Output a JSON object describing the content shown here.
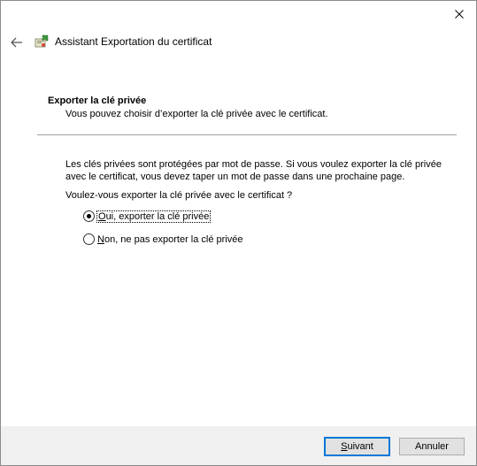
{
  "window": {
    "title": "Assistant Exportation du certificat",
    "close_icon": "close-icon",
    "back_icon": "back-arrow-icon",
    "wizard_icon": "certificate-wizard-icon"
  },
  "section": {
    "title": "Exporter la clé privée",
    "subtitle": "Vous pouvez choisir d’exporter la clé privée avec le certificat."
  },
  "info": {
    "text": "Les clés privées sont protégées par mot de passe. Si vous voulez exporter la clé privée avec le certificat, vous devez taper un mot de passe dans une prochaine page."
  },
  "question": "Voulez-vous exporter la clé privée avec le certificat ?",
  "options": [
    {
      "label_mnemonic": "O",
      "label_rest": "ui, exporter la clé privée",
      "selected": true
    },
    {
      "label_mnemonic": "N",
      "label_rest": "on, ne pas exporter la clé privée",
      "selected": false
    }
  ],
  "buttons": {
    "next_mnemonic": "S",
    "next_rest": "uivant",
    "cancel": "Annuler"
  },
  "colors": {
    "accent": "#0078d7",
    "footer_bg": "#f0f0f0",
    "separator": "#a0a0a0"
  }
}
